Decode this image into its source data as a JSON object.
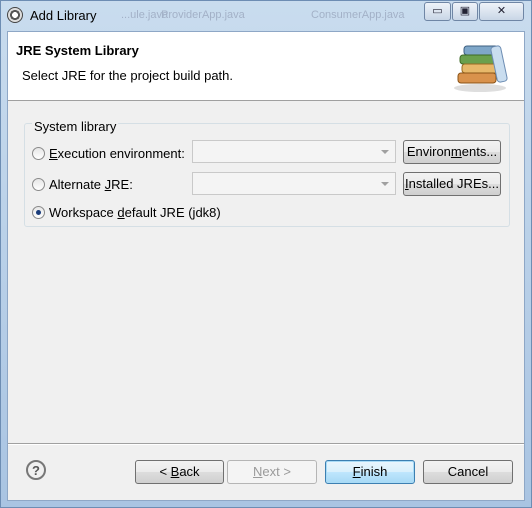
{
  "window": {
    "title": "Add Library",
    "background_tabs": [
      "...ule.java",
      "ProviderApp.java",
      "ConsumerApp.java"
    ],
    "controls": {
      "minimize": "▭",
      "maximize": "▣",
      "close": "✕"
    }
  },
  "header": {
    "title": "JRE System Library",
    "description": "Select JRE for the project build path."
  },
  "group": {
    "label": "System library",
    "options": [
      {
        "pre": "",
        "mnemonic": "E",
        "post": "xecution environment:",
        "checked": false
      },
      {
        "pre": "Alternate ",
        "mnemonic": "J",
        "post": "RE:",
        "checked": false
      },
      {
        "pre": "Workspace ",
        "mnemonic": "d",
        "post": "efault JRE (jdk8)",
        "checked": true
      }
    ],
    "buttons": {
      "environments": {
        "pre": "Environ",
        "mnemonic": "m",
        "post": "ents..."
      },
      "installed": {
        "pre": "",
        "mnemonic": "I",
        "post": "nstalled JREs..."
      }
    }
  },
  "footer": {
    "help": "?",
    "back": {
      "pre": "< ",
      "mnemonic": "B",
      "post": "ack"
    },
    "next": {
      "pre": "",
      "mnemonic": "N",
      "post": "ext >"
    },
    "finish": {
      "pre": "",
      "mnemonic": "F",
      "post": "inish"
    },
    "cancel": {
      "pre": "Cancel",
      "mnemonic": "",
      "post": ""
    }
  },
  "colors": {
    "accent": "#3c7fb1",
    "selected_radio": "#1a3c7a"
  }
}
